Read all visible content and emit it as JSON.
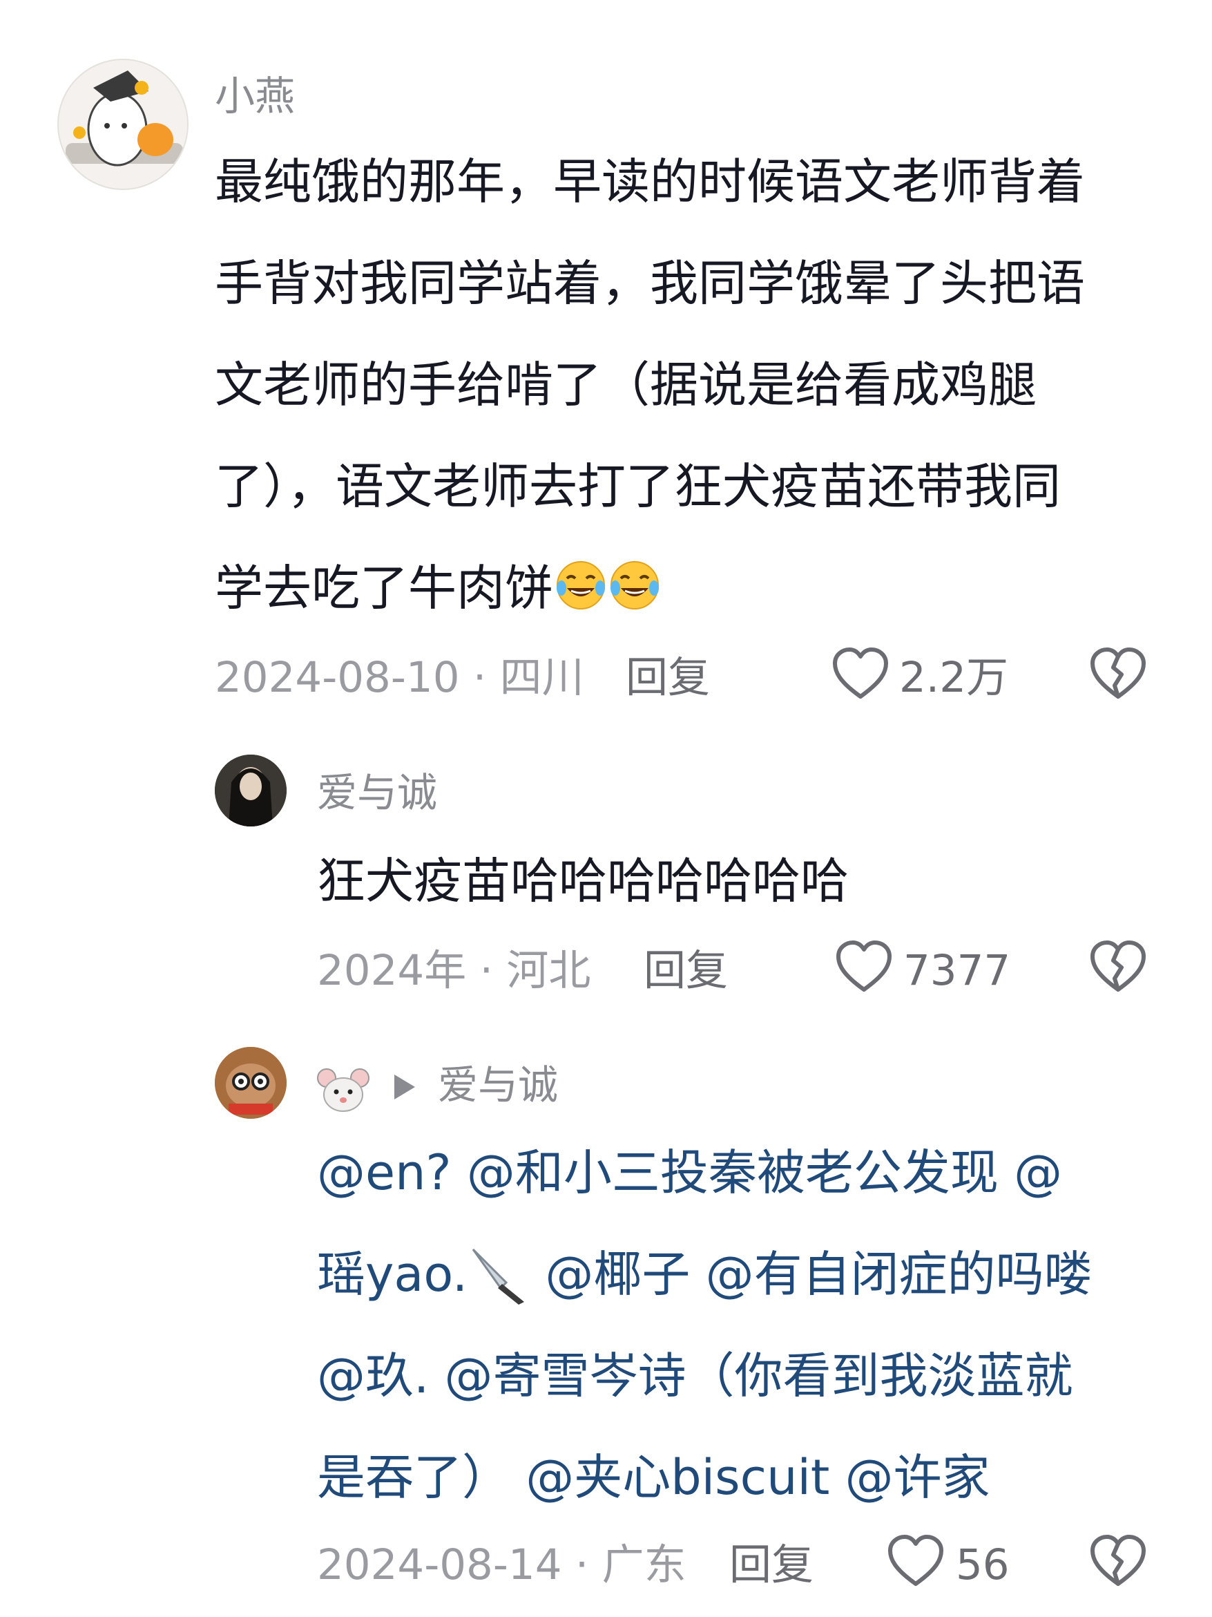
{
  "comments": [
    {
      "username": "小燕",
      "text_lines": [
        "最纯饿的那年，早读的时候语文老师背着",
        "手背对我同学站着，我同学饿晕了头把语",
        "文老师的手给啃了（据说是给看成鸡腿",
        "了），语文老师去打了狂犬疫苗还带我同",
        "学去吃了牛肉饼"
      ],
      "emoji": [
        "laughing-crying-emoji",
        "laughing-crying-emoji"
      ],
      "meta": "2024-08-10 · 四川",
      "reply_label": "回复",
      "like_count": "2.2万"
    },
    {
      "username": "爱与诚",
      "text": "狂犬疫苗哈哈哈哈哈哈哈",
      "meta": "2024年 · 河北",
      "reply_label": "回复",
      "like_count": "7377"
    },
    {
      "username_emoji": "mouse-face-emoji",
      "reply_to": "爱与诚",
      "text_lines": [
        "@en?  @和小三投秦被老公发现 @",
        "瑶yao.",
        " @椰子 @有自闭症的吗喽",
        "@玖. @寄雪岑诗（你看到我淡蓝就",
        "是吞了） @夹心biscuit @许家"
      ],
      "meta": "2024-08-14 · 广东",
      "reply_label": "回复",
      "like_count": "56"
    }
  ],
  "colors": {
    "text": "#161823",
    "mention": "#1f4a7a",
    "secondary": "#9a9ba1"
  },
  "icons": [
    "heart-icon",
    "broken-heart-icon",
    "knife-emoji"
  ]
}
